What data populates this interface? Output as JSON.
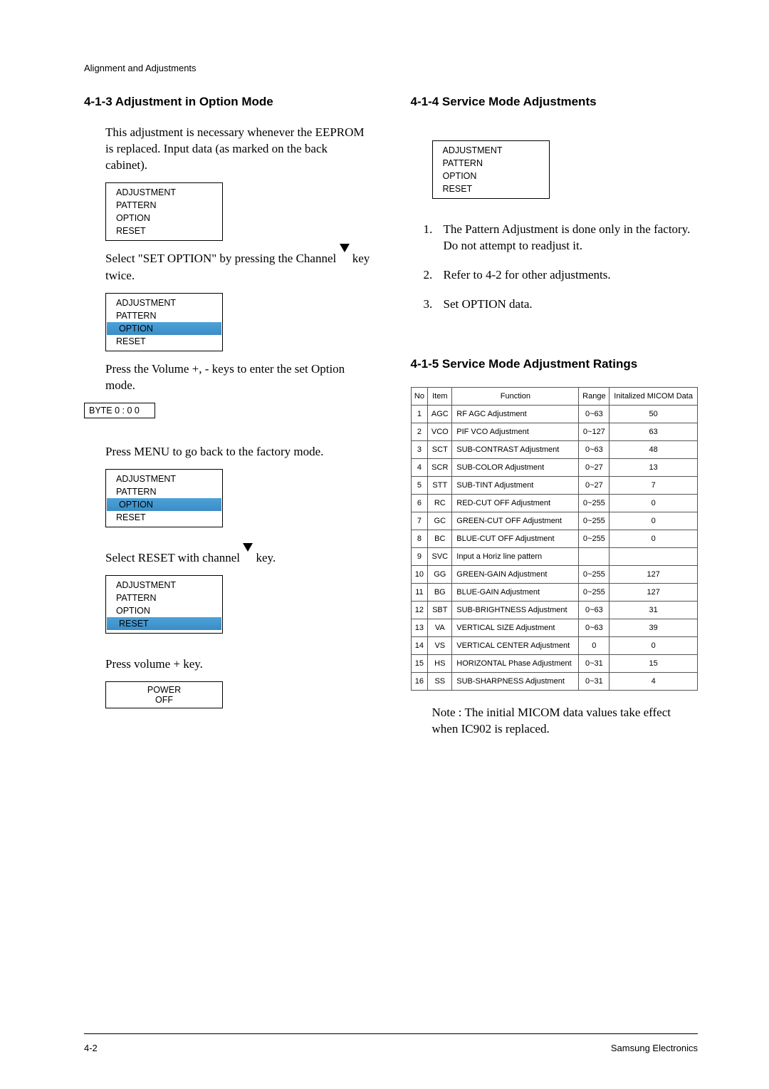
{
  "top_header": "Alignment and Adjustments",
  "left": {
    "h413": "4-1-3 Adjustment in Option Mode",
    "intro": "This adjustment is necessary whenever the EEPROM is replaced.  Input data (as marked on the back cabinet).",
    "menu1": {
      "r1": "ADJUSTMENT",
      "r2": "PATTERN",
      "r3": "OPTION",
      "r4": "RESET"
    },
    "select_text_a": "Select \"SET OPTION\" by pressing the Channel",
    "select_text_b": "key twice.",
    "menu2": {
      "r1": "ADJUSTMENT",
      "r2": "PATTERN",
      "r3": "OPTION",
      "r4": "RESET"
    },
    "volkeys": "Press the Volume  +, - keys to enter the set Option mode.",
    "byte": "BYTE  0 : 0 0",
    "menu_back": "Press MENU to go back to the factory mode.",
    "menu3": {
      "r1": "ADJUSTMENT",
      "r2": "PATTERN",
      "r3": "OPTION",
      "r4": "RESET"
    },
    "select_reset_a": "Select RESET with channel",
    "select_reset_b": "key.",
    "menu4": {
      "r1": "ADJUSTMENT",
      "r2": "PATTERN",
      "r3": "OPTION",
      "r4": "RESET"
    },
    "press_vol_plus": "Press volume + key.",
    "power": {
      "r1": "POWER",
      "r2": "OFF"
    }
  },
  "right": {
    "h414": "4-1-4  Service Mode Adjustments",
    "menu": {
      "r1": "ADJUSTMENT",
      "r2": "PATTERN",
      "r3": "OPTION",
      "r4": "RESET"
    },
    "list": {
      "l1": "The Pattern Adjustment is done only in the factory.  Do not attempt to readjust it.",
      "l2": "Refer to 4-2 for other adjustments.",
      "l3": "Set OPTION data."
    },
    "h415": "4-1-5 Service Mode Adjustment Ratings",
    "th": {
      "no": "No",
      "item": "Item",
      "fn": "Function",
      "range": "Range",
      "init": "Initalized MICOM Data"
    },
    "rows": [
      {
        "no": "1",
        "item": "AGC",
        "fn": "RF AGC Adjustment",
        "range": "0~63",
        "init": "50"
      },
      {
        "no": "2",
        "item": "VCO",
        "fn": "PIF VCO Adjustment",
        "range": "0~127",
        "init": "63"
      },
      {
        "no": "3",
        "item": "SCT",
        "fn": "SUB-CONTRAST Adjustment",
        "range": "0~63",
        "init": "48"
      },
      {
        "no": "4",
        "item": "SCR",
        "fn": "SUB-COLOR Adjustment",
        "range": "0~27",
        "init": "13"
      },
      {
        "no": "5",
        "item": "STT",
        "fn": "SUB-TINT Adjustment",
        "range": "0~27",
        "init": "7"
      },
      {
        "no": "6",
        "item": "RC",
        "fn": "RED-CUT OFF Adjustment",
        "range": "0~255",
        "init": "0"
      },
      {
        "no": "7",
        "item": "GC",
        "fn": "GREEN-CUT OFF Adjustment",
        "range": "0~255",
        "init": "0"
      },
      {
        "no": "8",
        "item": "BC",
        "fn": "BLUE-CUT OFF Adjustment",
        "range": "0~255",
        "init": "0"
      },
      {
        "no": "9",
        "item": "SVC",
        "fn": "Input a Horiz line pattern",
        "range": "",
        "init": ""
      },
      {
        "no": "10",
        "item": "GG",
        "fn": "GREEN-GAIN Adjustment",
        "range": "0~255",
        "init": "127"
      },
      {
        "no": "11",
        "item": "BG",
        "fn": "BLUE-GAIN Adjustment",
        "range": "0~255",
        "init": "127"
      },
      {
        "no": "12",
        "item": "SBT",
        "fn": "SUB-BRIGHTNESS Adjustment",
        "range": "0~63",
        "init": "31"
      },
      {
        "no": "13",
        "item": "VA",
        "fn": "VERTICAL SIZE Adjustment",
        "range": "0~63",
        "init": "39"
      },
      {
        "no": "14",
        "item": "VS",
        "fn": "VERTICAL CENTER Adjustment",
        "range": "0",
        "init": "0"
      },
      {
        "no": "15",
        "item": "HS",
        "fn": "HORIZONTAL Phase Adjustment",
        "range": "0~31",
        "init": "15"
      },
      {
        "no": "16",
        "item": "SS",
        "fn": "SUB-SHARPNESS Adjustment",
        "range": "0~31",
        "init": "4"
      }
    ],
    "note": "Note : The initial MICOM data values take effect when IC902 is replaced."
  },
  "footer": {
    "left": "4-2",
    "right": "Samsung Electronics"
  }
}
